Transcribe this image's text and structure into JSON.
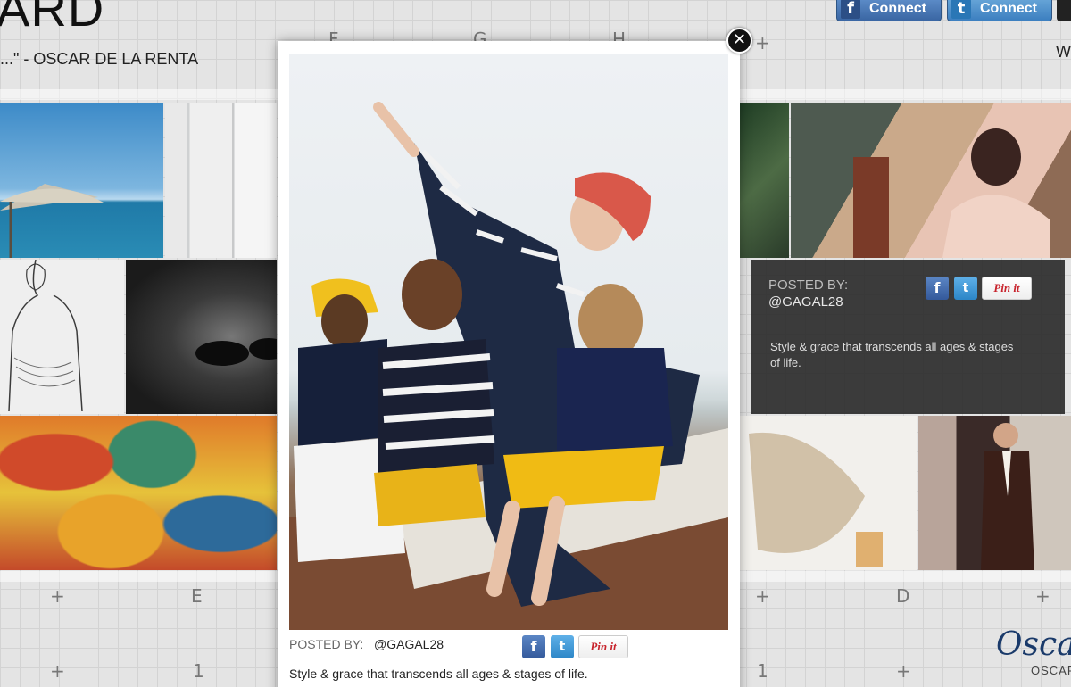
{
  "header": {
    "title": "ARD",
    "quote": "...\" - OSCAR DE LA RENTA",
    "fb_connect_label": "Connect",
    "tw_connect_label": "Connect",
    "right_edge_text": "W",
    "fb_icon": "f",
    "tw_icon": "t"
  },
  "grid_labels": {
    "top": [
      "F",
      "G",
      "H",
      "+"
    ],
    "bottom_row1": [
      "+",
      "E",
      "+",
      "+",
      "D",
      "+"
    ],
    "bottom_row2": [
      "+",
      "1",
      "1",
      "+"
    ]
  },
  "feature_card": {
    "posted_by_label": "POSTED BY:",
    "username": "@GAGAL28",
    "description": "Style & grace that transcends all ages & stages of life.",
    "pin_label": "Pin it"
  },
  "modal": {
    "posted_by_label": "POSTED BY:",
    "username": "@GAGAL28",
    "description": "Style & grace that transcends all ages & stages of life.",
    "pin_label": "Pin it",
    "close_label": "✕"
  },
  "footer_logo": {
    "script": "Osca",
    "sub": "OSCAR"
  },
  "colors": {
    "facebook": "#3b5998",
    "twitter": "#2c86c7",
    "pinterest": "#c8232c"
  }
}
